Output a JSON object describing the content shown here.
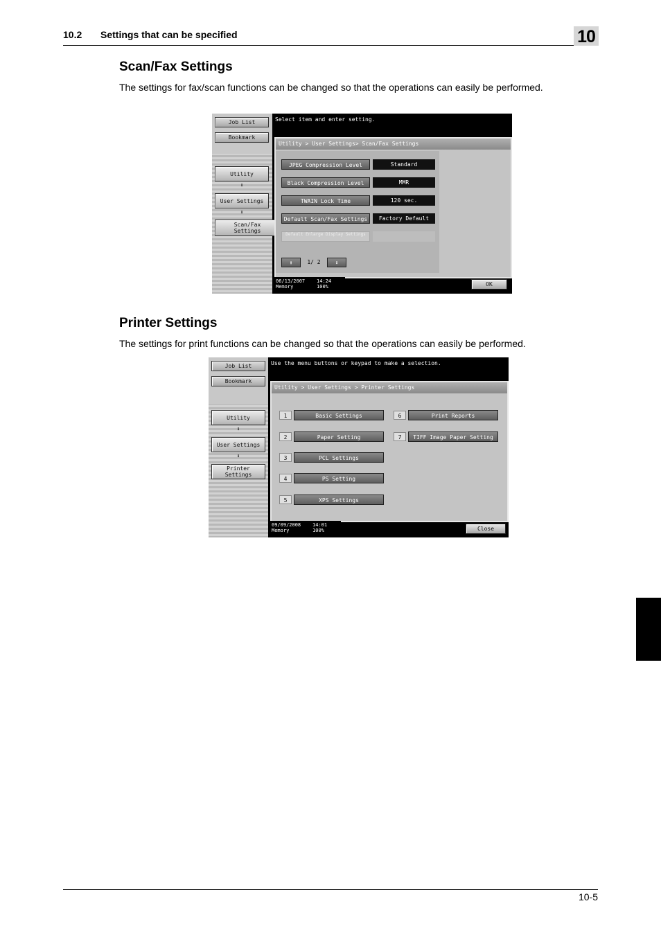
{
  "header": {
    "section": "10.2",
    "title": "Settings that can be specified",
    "chapter": "10"
  },
  "scanfax": {
    "heading": "Scan/Fax Settings",
    "description": "The settings for fax/scan functions can be changed so that the operations can easily be performed.",
    "screen": {
      "side": {
        "job_list": "Job List",
        "bookmark": "Bookmark",
        "utility": "Utility",
        "user_settings": "User Settings",
        "scanfax_settings": "Scan/Fax Settings"
      },
      "message": "Select item and enter setting.",
      "breadcrumb": "Utility > User Settings> Scan/Fax Settings",
      "items": [
        {
          "label": "JPEG Compression Level",
          "value": "Standard"
        },
        {
          "label": "Black Compression Level",
          "value": "MMR"
        },
        {
          "label": "TWAIN Lock Time",
          "value": "120    sec."
        },
        {
          "label": "Default Scan/Fax Settings",
          "value": "Factory Default"
        },
        {
          "label": "Default Enlarge Display Settings",
          "value": ""
        }
      ],
      "page": "1/ 2",
      "up_arrow": "⬆",
      "down_arrow": "⬇",
      "date": "06/13/2007",
      "time": "14:24",
      "memory_label": "Memory",
      "memory_value": "100%",
      "ok": "OK"
    }
  },
  "printer": {
    "heading": "Printer Settings",
    "description": "The settings for print functions can be changed so that the operations can easily be performed.",
    "screen": {
      "side": {
        "job_list": "Job List",
        "bookmark": "Bookmark",
        "utility": "Utility",
        "user_settings": "User Settings",
        "printer_settings": "Printer Settings"
      },
      "message": "Use the menu buttons or keypad to make a selection.",
      "breadcrumb": "Utility > User Settings > Printer Settings",
      "items_left": [
        {
          "num": "1",
          "label": "Basic Settings"
        },
        {
          "num": "2",
          "label": "Paper Setting"
        },
        {
          "num": "3",
          "label": "PCL Settings"
        },
        {
          "num": "4",
          "label": "PS Setting"
        },
        {
          "num": "5",
          "label": "XPS Settings"
        }
      ],
      "items_right": [
        {
          "num": "6",
          "label": "Print Reports"
        },
        {
          "num": "7",
          "label": "TIFF Image Paper Setting"
        }
      ],
      "date": "09/09/2008",
      "time": "14:01",
      "memory_label": "Memory",
      "memory_value": "100%",
      "close": "Close"
    }
  },
  "footer": {
    "page": "10-5"
  }
}
